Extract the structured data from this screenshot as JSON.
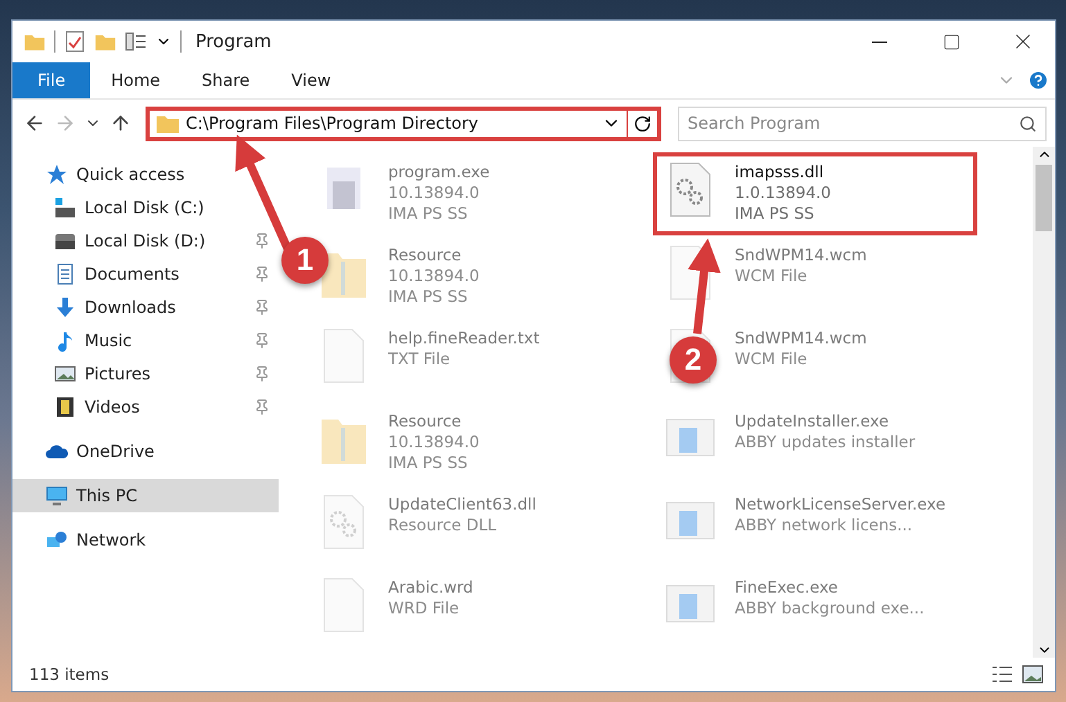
{
  "window": {
    "title": "Program"
  },
  "ribbon_tabs": [
    {
      "label": "File",
      "selected": true
    },
    {
      "label": "Home",
      "selected": false
    },
    {
      "label": "Share",
      "selected": false
    },
    {
      "label": "View",
      "selected": false
    }
  ],
  "address": {
    "value": "C:\\Program Files\\Program Directory",
    "highlighted": true
  },
  "search": {
    "placeholder": "Search Program"
  },
  "sidebar": {
    "items": [
      {
        "label": "Quick access",
        "kind": "star",
        "selected": false,
        "children": [
          {
            "label": "Local Disk (C:)",
            "kind": "system-disk",
            "pinned": false
          },
          {
            "label": "Local Disk (D:)",
            "kind": "disk",
            "pinned": true
          },
          {
            "label": "Documents",
            "kind": "documents",
            "pinned": true
          },
          {
            "label": "Downloads",
            "kind": "downloads",
            "pinned": true
          },
          {
            "label": "Music",
            "kind": "music",
            "pinned": true
          },
          {
            "label": "Pictures",
            "kind": "pictures",
            "pinned": true
          },
          {
            "label": "Videos",
            "kind": "videos",
            "pinned": true
          }
        ]
      },
      {
        "label": "OneDrive",
        "kind": "cloud",
        "selected": false
      },
      {
        "label": "This PC",
        "kind": "computer",
        "selected": true
      },
      {
        "label": "Network",
        "kind": "network",
        "selected": false
      }
    ]
  },
  "files": [
    {
      "name": "program.exe",
      "details": [
        "10.13894.0",
        "IMA PS SS"
      ],
      "kind": "program",
      "highlighted": false
    },
    {
      "name": "imapsss.dll",
      "details": [
        "1.0.13894.0",
        "IMA PS SS"
      ],
      "kind": "settings",
      "highlighted": true
    },
    {
      "name": "Resource",
      "details": [
        "10.13894.0",
        "IMA PS SS"
      ],
      "kind": "folder",
      "highlighted": false
    },
    {
      "name": "SndWPM14.wcm",
      "details": [
        "WCM File"
      ],
      "kind": "blank",
      "highlighted": false
    },
    {
      "name": "help.fineReader.txt",
      "details": [
        "TXT File"
      ],
      "kind": "blank",
      "highlighted": false
    },
    {
      "name": "SndWPM14.wcm",
      "details": [
        "WCM File"
      ],
      "kind": "blank",
      "highlighted": false
    },
    {
      "name": "Resource",
      "details": [
        "10.13894.0",
        "IMA PS SS"
      ],
      "kind": "folder",
      "highlighted": false
    },
    {
      "name": "UpdateInstaller.exe",
      "details": [
        "ABBY updates installer"
      ],
      "kind": "window",
      "highlighted": false
    },
    {
      "name": "UpdateClient63.dll",
      "details": [
        "Resource DLL"
      ],
      "kind": "settings",
      "highlighted": false
    },
    {
      "name": "NetworkLicenseServer.exe",
      "details": [
        "ABBY network licens..."
      ],
      "kind": "window",
      "highlighted": false
    },
    {
      "name": "Arabic.wrd",
      "details": [
        "WRD File"
      ],
      "kind": "blank",
      "highlighted": false
    },
    {
      "name": "FineExec.exe",
      "details": [
        "ABBY background exe..."
      ],
      "kind": "window",
      "highlighted": false
    }
  ],
  "status_bar": {
    "item_count": "113 items"
  },
  "annotations": [
    {
      "number": "1"
    },
    {
      "number": "2"
    }
  ]
}
